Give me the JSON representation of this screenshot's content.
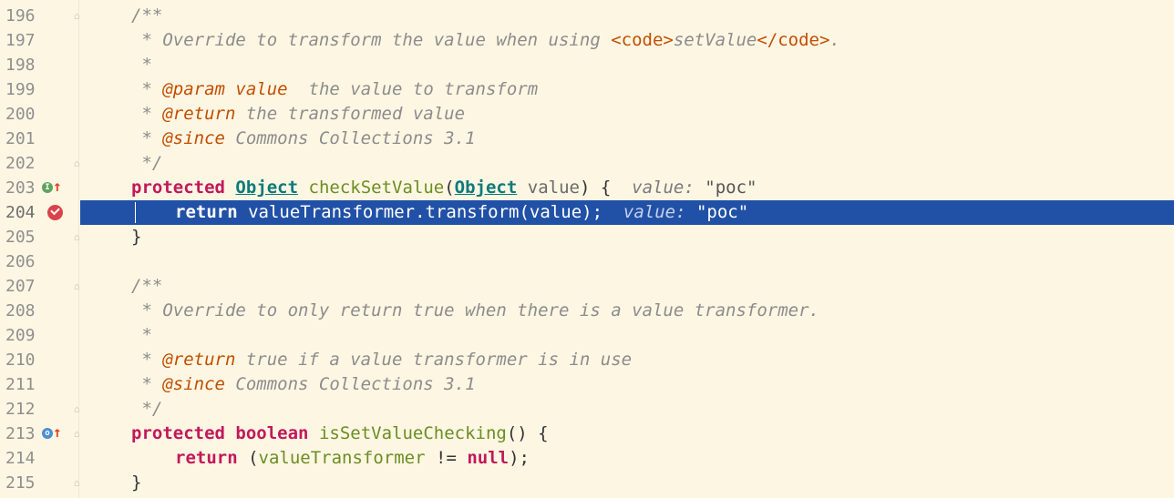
{
  "editor": {
    "lines": [
      {
        "num": "196",
        "segments": [
          {
            "t": "/**",
            "c": "c-comment"
          }
        ]
      },
      {
        "num": "197",
        "segments": [
          {
            "t": " * Override to transform the value when using ",
            "c": "c-comment"
          },
          {
            "t": "<code>",
            "c": "c-html"
          },
          {
            "t": "setValue",
            "c": "c-comment"
          },
          {
            "t": "</code>",
            "c": "c-html"
          },
          {
            "t": ".",
            "c": "c-comment"
          }
        ]
      },
      {
        "num": "198",
        "segments": [
          {
            "t": " *",
            "c": "c-comment"
          }
        ]
      },
      {
        "num": "199",
        "segments": [
          {
            "t": " * ",
            "c": "c-comment"
          },
          {
            "t": "@param",
            "c": "c-tag"
          },
          {
            "t": " ",
            "c": "c-comment"
          },
          {
            "t": "value",
            "c": "c-tag"
          },
          {
            "t": "  the value to transform",
            "c": "c-comment"
          }
        ]
      },
      {
        "num": "200",
        "segments": [
          {
            "t": " * ",
            "c": "c-comment"
          },
          {
            "t": "@return",
            "c": "c-tag"
          },
          {
            "t": " the transformed value",
            "c": "c-comment"
          }
        ]
      },
      {
        "num": "201",
        "segments": [
          {
            "t": " * ",
            "c": "c-comment"
          },
          {
            "t": "@since",
            "c": "c-tag"
          },
          {
            "t": " Commons Collections 3.1",
            "c": "c-comment"
          }
        ]
      },
      {
        "num": "202",
        "segments": [
          {
            "t": " */",
            "c": "c-comment"
          }
        ]
      },
      {
        "num": "203",
        "segments": [
          {
            "t": "protected",
            "c": "c-kw"
          },
          {
            "t": " ",
            "c": "c-text"
          },
          {
            "t": "Object",
            "c": "c-type"
          },
          {
            "t": " ",
            "c": "c-text"
          },
          {
            "t": "checkSetValue",
            "c": "c-method"
          },
          {
            "t": "(",
            "c": "c-text"
          },
          {
            "t": "Object",
            "c": "c-type"
          },
          {
            "t": " ",
            "c": "c-text"
          },
          {
            "t": "value",
            "c": "c-param"
          },
          {
            "t": ") {  ",
            "c": "c-text"
          },
          {
            "t": "value:",
            "c": "c-hint"
          },
          {
            "t": " \"poc\"",
            "c": "c-hintval"
          }
        ]
      },
      {
        "num": "204",
        "exec": true,
        "segments": [
          {
            "t": "return",
            "c": "k"
          },
          {
            "t": " valueTransformer.transform(value);  ",
            "c": ""
          },
          {
            "t": "value:",
            "c": "h"
          },
          {
            "t": " \"poc\"",
            "c": ""
          }
        ]
      },
      {
        "num": "205",
        "segments": [
          {
            "t": "}",
            "c": "c-text"
          }
        ]
      },
      {
        "num": "206",
        "segments": []
      },
      {
        "num": "207",
        "segments": [
          {
            "t": "/**",
            "c": "c-comment"
          }
        ]
      },
      {
        "num": "208",
        "segments": [
          {
            "t": " * Override to only return true when there is a value transformer.",
            "c": "c-comment"
          }
        ]
      },
      {
        "num": "209",
        "segments": [
          {
            "t": " *",
            "c": "c-comment"
          }
        ]
      },
      {
        "num": "210",
        "segments": [
          {
            "t": " * ",
            "c": "c-comment"
          },
          {
            "t": "@return",
            "c": "c-tag"
          },
          {
            "t": " true if a value transformer is in use",
            "c": "c-comment"
          }
        ]
      },
      {
        "num": "211",
        "segments": [
          {
            "t": " * ",
            "c": "c-comment"
          },
          {
            "t": "@since",
            "c": "c-tag"
          },
          {
            "t": " Commons Collections 3.1",
            "c": "c-comment"
          }
        ]
      },
      {
        "num": "212",
        "segments": [
          {
            "t": " */",
            "c": "c-comment"
          }
        ]
      },
      {
        "num": "213",
        "segments": [
          {
            "t": "protected",
            "c": "c-kw"
          },
          {
            "t": " ",
            "c": "c-text"
          },
          {
            "t": "boolean",
            "c": "c-kw"
          },
          {
            "t": " ",
            "c": "c-text"
          },
          {
            "t": "isSetValueChecking",
            "c": "c-method"
          },
          {
            "t": "() {",
            "c": "c-text"
          }
        ]
      },
      {
        "num": "214",
        "indent": true,
        "segments": [
          {
            "t": "return",
            "c": "c-kw"
          },
          {
            "t": " (",
            "c": "c-text"
          },
          {
            "t": "valueTransformer",
            "c": "c-field"
          },
          {
            "t": " != ",
            "c": "c-text"
          },
          {
            "t": "null",
            "c": "c-kw"
          },
          {
            "t": ");",
            "c": "c-text"
          }
        ]
      },
      {
        "num": "215",
        "segments": [
          {
            "t": "}",
            "c": "c-text"
          }
        ]
      }
    ],
    "gutter_icons": {
      "203": [
        "implementing-method-icon",
        "override-up-arrow-icon"
      ],
      "204": [
        "breakpoint-icon"
      ],
      "213": [
        "overriding-method-icon",
        "override-up-arrow-icon"
      ]
    },
    "fold_markers": [
      "196",
      "202",
      "205",
      "207",
      "212",
      "213",
      "215"
    ],
    "colors": {
      "background": "#fdf6e3",
      "execution_line": "#2151a6",
      "keyword": "#c2185b",
      "comment": "#8c8c8c",
      "doc_tag": "#c24e00",
      "method": "#6b8e23",
      "type": "#0d7a7a",
      "breakpoint": "#d9434a"
    }
  }
}
